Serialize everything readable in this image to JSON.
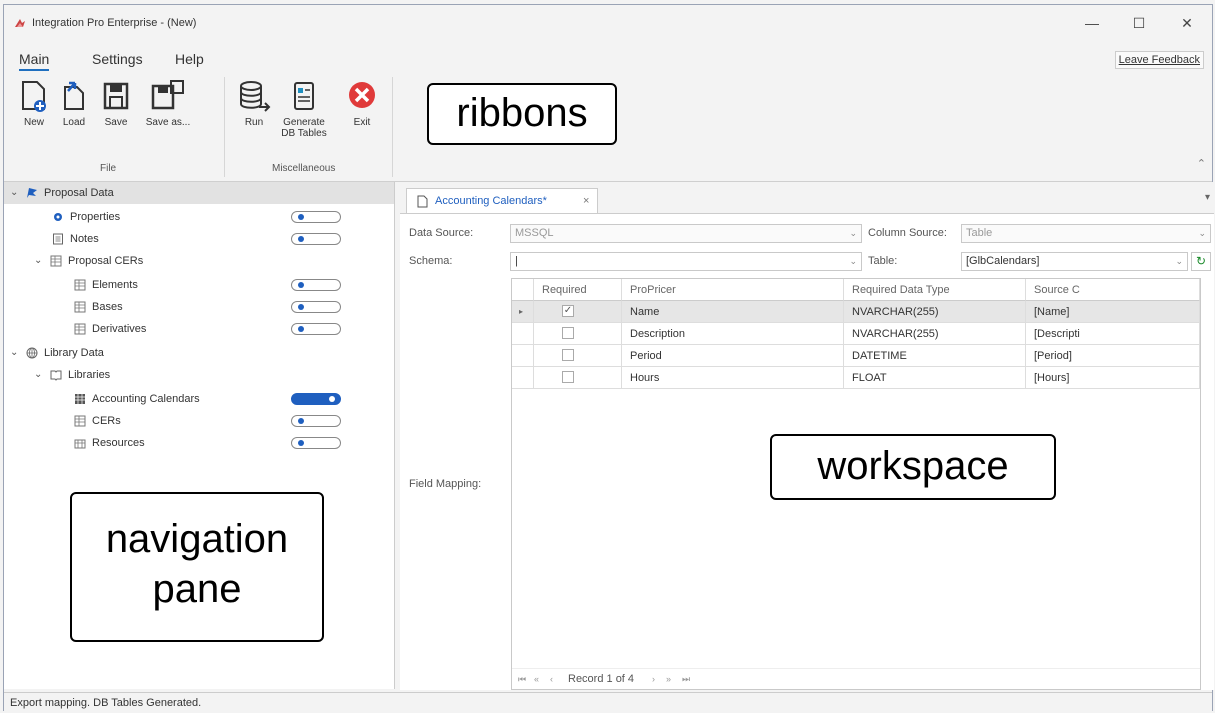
{
  "window": {
    "title": "Integration Pro Enterprise - (New)",
    "minimize": "—",
    "maximize": "☐",
    "close": "✕"
  },
  "menu": {
    "tabs": [
      "Main",
      "Settings",
      "Help"
    ],
    "feedback": "Leave Feedback"
  },
  "ribbon": {
    "groups": [
      {
        "label": "File",
        "buttons": [
          "New",
          "Load",
          "Save",
          "Save as..."
        ]
      },
      {
        "label": "Miscellaneous",
        "buttons": [
          "Run",
          "Generate DB Tables",
          "Exit"
        ]
      }
    ],
    "callout": "ribbons"
  },
  "nav": {
    "callout": "navigation pane",
    "items": [
      {
        "label": "Proposal Data",
        "level": 0,
        "expanded": true,
        "icon": "flag-icon",
        "toggle": null
      },
      {
        "label": "Properties",
        "level": 1,
        "icon": "gear-icon",
        "toggle": "off"
      },
      {
        "label": "Notes",
        "level": 1,
        "icon": "note-icon",
        "toggle": "off"
      },
      {
        "label": "Proposal CERs",
        "level": 1,
        "expanded": true,
        "icon": "table-icon",
        "toggle": null
      },
      {
        "label": "Elements",
        "level": 2,
        "icon": "table-icon",
        "toggle": "off"
      },
      {
        "label": "Bases",
        "level": 2,
        "icon": "table-icon",
        "toggle": "off"
      },
      {
        "label": "Derivatives",
        "level": 2,
        "icon": "table-icon",
        "toggle": "off"
      },
      {
        "label": "Library Data",
        "level": 0,
        "expanded": true,
        "icon": "globe-icon",
        "toggle": null
      },
      {
        "label": "Libraries",
        "level": 1,
        "expanded": true,
        "icon": "book-icon",
        "toggle": null
      },
      {
        "label": "Accounting Calendars",
        "level": 2,
        "icon": "calendar-icon",
        "toggle": "on"
      },
      {
        "label": "CERs",
        "level": 2,
        "icon": "table-icon",
        "toggle": "off"
      },
      {
        "label": "Resources",
        "level": 2,
        "icon": "table-icon",
        "toggle": "off"
      }
    ]
  },
  "workspace": {
    "callout": "workspace",
    "tab": {
      "label": "Accounting Calendars*",
      "close": "×"
    },
    "fields": {
      "data_source_label": "Data Source:",
      "data_source_value": "MSSQL",
      "column_source_label": "Column Source:",
      "column_source_value": "Table",
      "schema_label": "Schema:",
      "schema_value": "|",
      "table_label": "Table:",
      "table_value": "[GlbCalendars]",
      "field_mapping_label": "Field Mapping:"
    },
    "grid": {
      "columns": [
        "Required",
        "ProPricer",
        "Required Data Type",
        "Source C"
      ],
      "rows": [
        {
          "required": true,
          "propricer": "Name",
          "type": "NVARCHAR(255)",
          "source": "[Name]"
        },
        {
          "required": false,
          "propricer": "Description",
          "type": "NVARCHAR(255)",
          "source": "[Descripti"
        },
        {
          "required": false,
          "propricer": "Period",
          "type": "DATETIME",
          "source": "[Period]"
        },
        {
          "required": false,
          "propricer": "Hours",
          "type": "FLOAT",
          "source": "[Hours]"
        }
      ],
      "navigator": "Record 1 of 4"
    }
  },
  "status": "Export mapping. DB Tables Generated.",
  "colors": {
    "accent": "#1f5fbf",
    "exit": "#e03a3a"
  }
}
